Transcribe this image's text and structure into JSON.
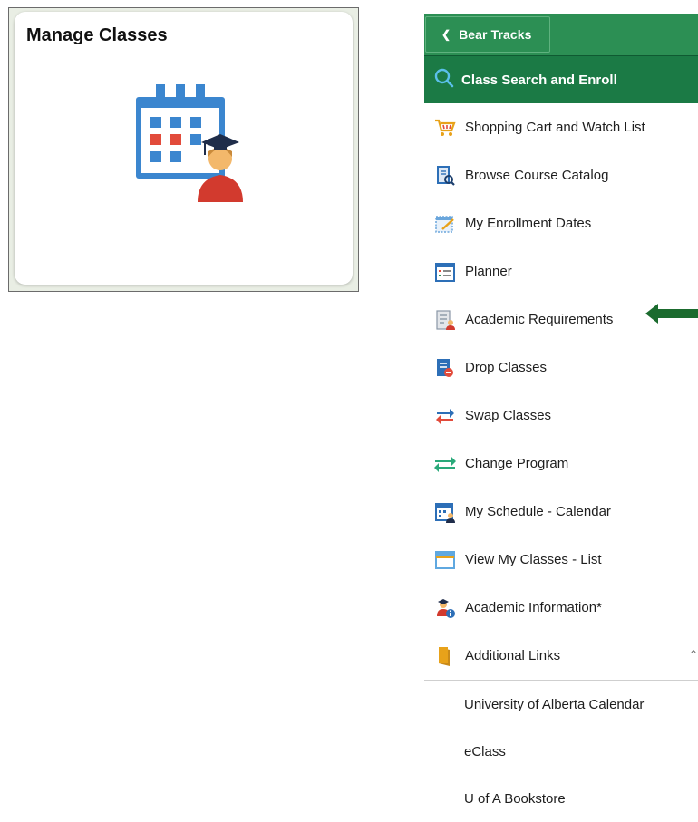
{
  "tile": {
    "title": "Manage Classes",
    "icon": "calendar-graduate-icon"
  },
  "nav": {
    "back_label": "Bear Tracks",
    "back_icon": "chevron-left-icon",
    "search_label": "Class Search and Enroll",
    "search_icon": "search-icon",
    "items": [
      {
        "label": "Shopping Cart and Watch List",
        "icon": "shopping-cart-icon"
      },
      {
        "label": "Browse Course Catalog",
        "icon": "catalog-icon"
      },
      {
        "label": "My Enrollment Dates",
        "icon": "enrollment-dates-icon"
      },
      {
        "label": "Planner",
        "icon": "planner-icon"
      },
      {
        "label": "Academic Requirements",
        "icon": "academic-requirements-icon"
      },
      {
        "label": "Drop Classes",
        "icon": "drop-classes-icon"
      },
      {
        "label": "Swap Classes",
        "icon": "swap-classes-icon"
      },
      {
        "label": "Change Program",
        "icon": "change-program-icon"
      },
      {
        "label": "My Schedule - Calendar",
        "icon": "schedule-calendar-icon"
      },
      {
        "label": "View My Classes - List",
        "icon": "classes-list-icon"
      },
      {
        "label": "Academic Information*",
        "icon": "academic-information-icon"
      },
      {
        "label": "Additional Links",
        "icon": "folder-icon",
        "expanded": true
      }
    ],
    "sub_items": [
      {
        "label": "University of Alberta Calendar"
      },
      {
        "label": "eClass"
      },
      {
        "label": "U of A Bookstore"
      }
    ]
  },
  "colors": {
    "header_green": "#2c8f54",
    "search_green": "#1b7a45",
    "arrow_green": "#1b6b2e"
  }
}
